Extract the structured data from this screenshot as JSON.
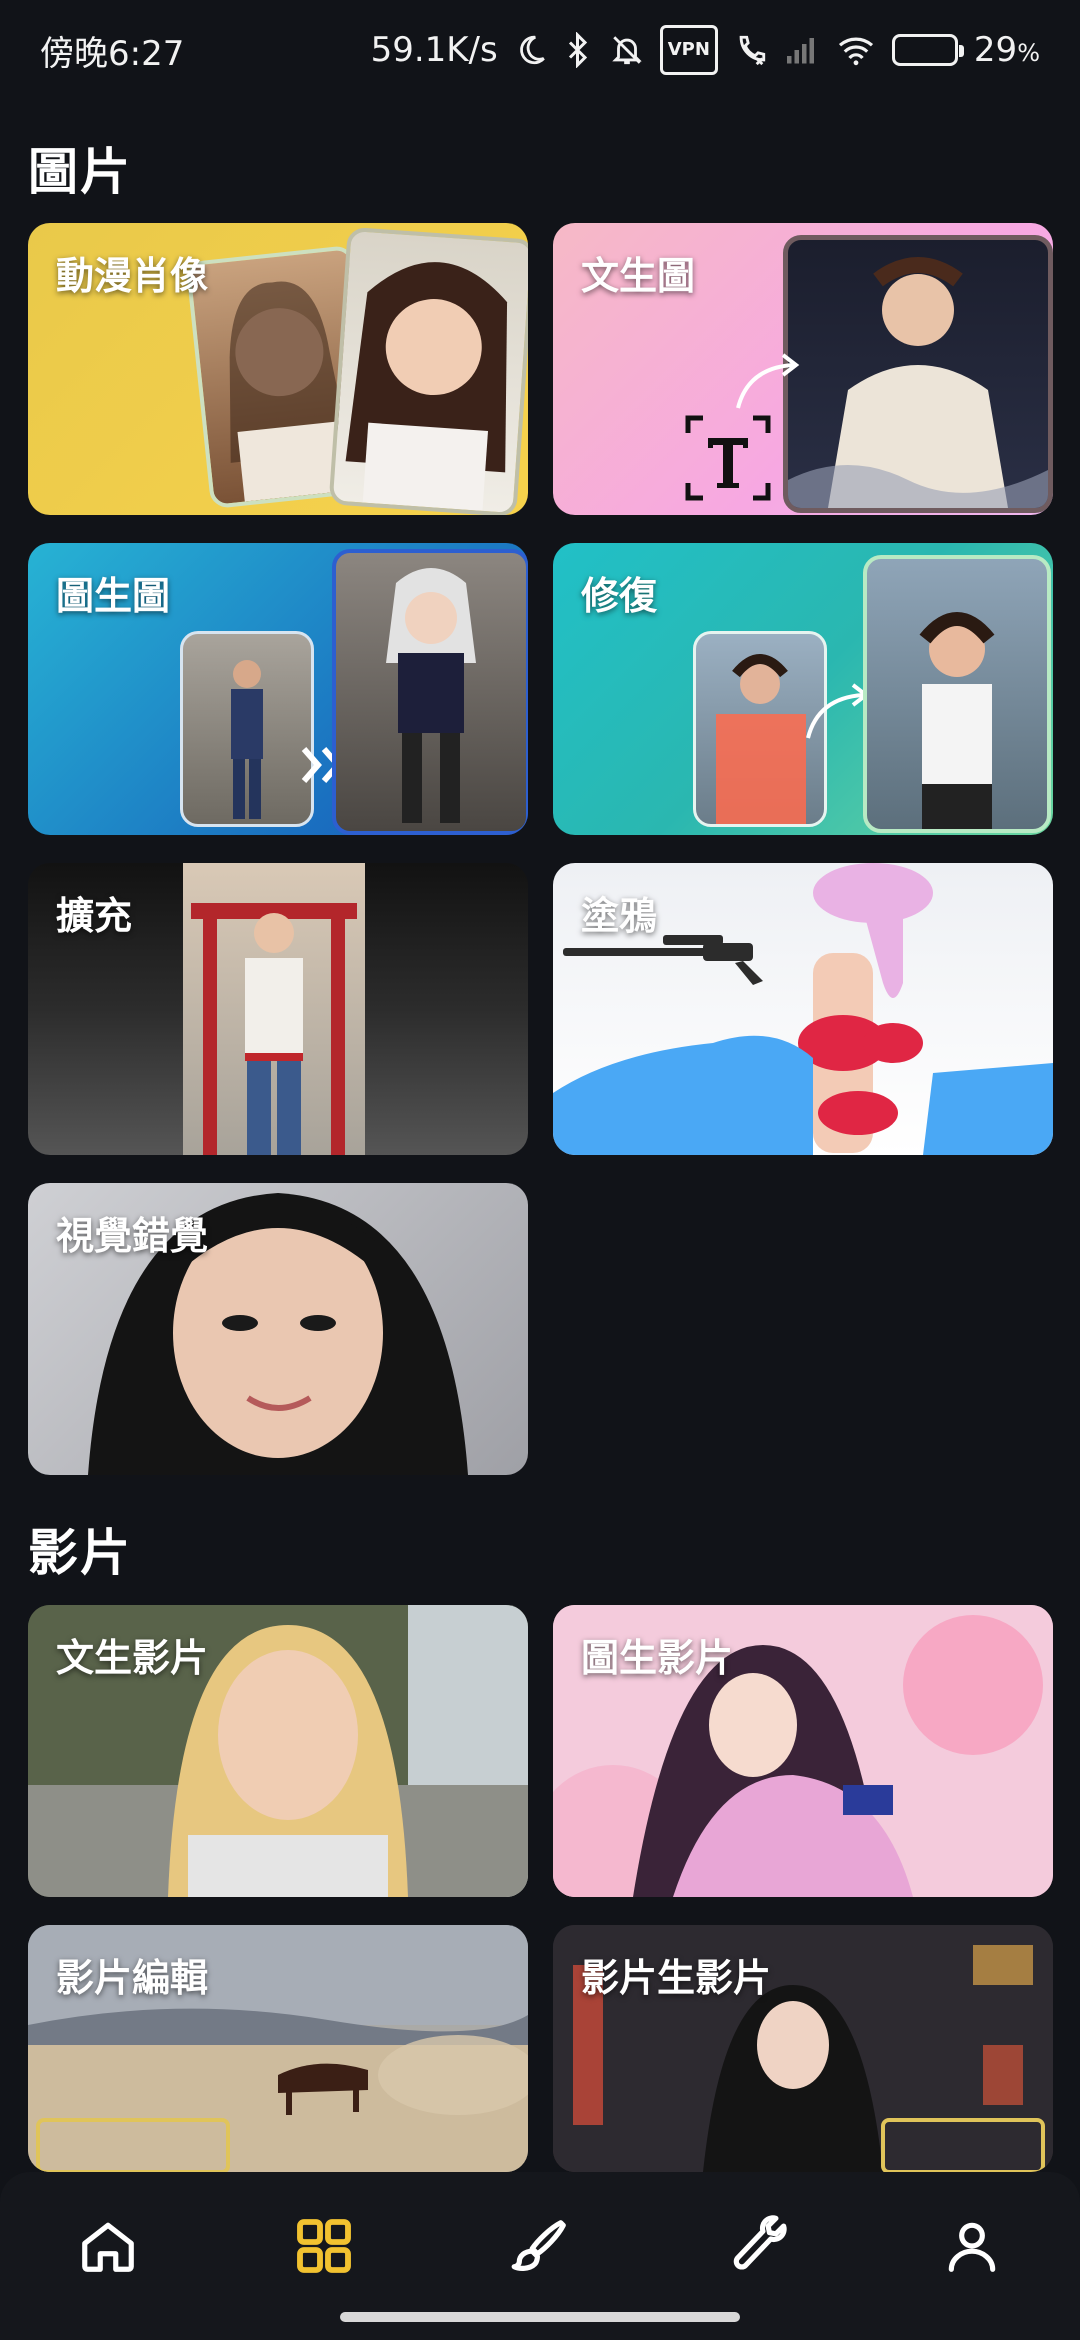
{
  "status_bar": {
    "time": "傍晚6:27",
    "speed": "59.1K/s",
    "vpn": "VPN",
    "battery": "29",
    "battery_unit": "%",
    "battery_level": 0.29
  },
  "sections": {
    "images": {
      "title": "圖片",
      "cards": [
        {
          "label": "動漫肖像"
        },
        {
          "label": "文生圖"
        },
        {
          "label": "圖生圖"
        },
        {
          "label": "修復"
        },
        {
          "label": "擴充"
        },
        {
          "label": "塗鴉"
        },
        {
          "label": "視覺錯覺"
        }
      ]
    },
    "videos": {
      "title": "影片",
      "cards": [
        {
          "label": "文生影片"
        },
        {
          "label": "圖生影片"
        },
        {
          "label": "影片編輯"
        },
        {
          "label": "影片生影片"
        }
      ]
    }
  },
  "bottom_nav": {
    "items": [
      {
        "icon": "home-icon"
      },
      {
        "icon": "grid-icon",
        "active": true
      },
      {
        "icon": "brush-icon"
      },
      {
        "icon": "wrench-icon"
      },
      {
        "icon": "profile-icon"
      }
    ],
    "active_color": "#f2c230",
    "inactive_color": "#ffffff"
  }
}
